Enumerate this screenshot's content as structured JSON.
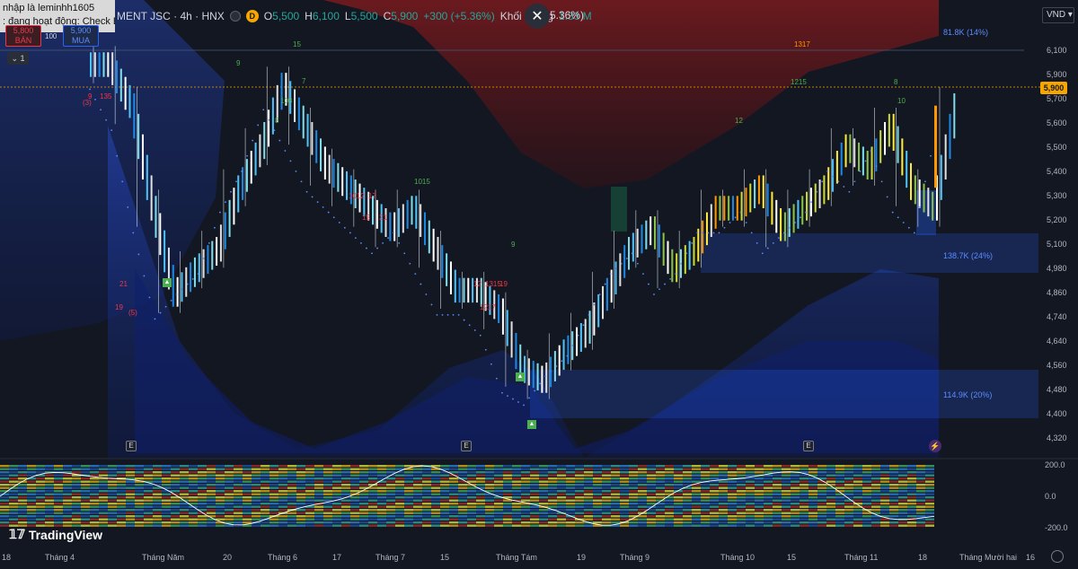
{
  "tooltip": {
    "line1": "nhập là leminhh1605",
    "line2": ": đang hoạt động: Check BTC"
  },
  "header": {
    "symbol": "MENT JSC · 4h · HNX",
    "d_badge": "D",
    "ohlc": {
      "o_label": "O",
      "o": "5,500",
      "h_label": "H",
      "h": "6,100",
      "l_label": "L",
      "l": "5,500",
      "c_label": "C",
      "c": "5,900",
      "change": "+300 (+5.36%)",
      "volume_label": "Khối lượng",
      "volume": "1.33 M"
    },
    "change_pct_2": "5.36%)"
  },
  "trade": {
    "sell_price": "5,800",
    "sell_label": "BÁN",
    "spread": "100",
    "buy_price": "5,900",
    "buy_label": "MUA"
  },
  "collapse_label": "1",
  "currency": "VND",
  "price_axis": [
    "6,100",
    "5,900",
    "5,700",
    "5,600",
    "5,500",
    "5,400",
    "5,300",
    "5,200",
    "5,100",
    "4,980",
    "4,860",
    "4,740",
    "4,640",
    "4,560",
    "4,480",
    "4,400",
    "4,320"
  ],
  "current_price": "5,900",
  "osc_axis": [
    "200.0",
    "0.0",
    "-200.0"
  ],
  "zones": {
    "z1": "81.8K (14%)",
    "z2": "138.7K (24%)",
    "z3": "114.9K (20%)"
  },
  "time_axis": [
    "18",
    "Tháng 4",
    "Tháng Năm",
    "20",
    "Tháng 6",
    "17",
    "Tháng 7",
    "15",
    "Tháng Tám",
    "19",
    "Tháng 9",
    "Tháng 10",
    "15",
    "Tháng 11",
    "18",
    "Tháng Mười hai",
    "16"
  ],
  "events": {
    "e": "E",
    "flash": "⚡"
  },
  "brand": "TradingView",
  "signals": [
    {
      "t": "9",
      "c": "red"
    },
    {
      "t": "135",
      "c": "red"
    },
    {
      "t": "(3)",
      "c": "red"
    },
    {
      "t": "21",
      "c": "red"
    },
    {
      "t": "19",
      "c": "red"
    },
    {
      "t": "(5)",
      "c": "red"
    },
    {
      "t": "15",
      "c": "green"
    },
    {
      "t": "9",
      "c": "green"
    },
    {
      "t": "7",
      "c": "green"
    },
    {
      "t": "108",
      "c": "green"
    },
    {
      "t": "8",
      "c": "green"
    },
    {
      "t": "1012",
      "c": "red"
    },
    {
      "t": "17",
      "c": "red"
    },
    {
      "t": "15",
      "c": "red"
    },
    {
      "t": "21",
      "c": "red"
    },
    {
      "t": "12",
      "c": "red"
    },
    {
      "t": "1315",
      "c": "red"
    },
    {
      "t": "19",
      "c": "red"
    },
    {
      "t": "1217",
      "c": "red"
    },
    {
      "t": "1015",
      "c": "green"
    },
    {
      "t": "9",
      "c": "green"
    },
    {
      "t": "12",
      "c": "green"
    },
    {
      "t": "1215",
      "c": "green"
    },
    {
      "t": "1317",
      "c": "orange"
    },
    {
      "t": "8",
      "c": "green"
    },
    {
      "t": "10",
      "c": "green"
    }
  ],
  "colors": {
    "bg": "#131722",
    "accent": "#f7a600",
    "up": "#26a69a",
    "down": "#f23645",
    "band_blue": "#1e3fa8",
    "band_red": "#8b1a1a"
  },
  "chart_data": {
    "type": "candlestick",
    "title": "",
    "timeframe": "4h",
    "exchange": "HNX",
    "ylim": [
      4280,
      6240
    ],
    "current": {
      "open": 5500,
      "high": 6100,
      "low": 5500,
      "close": 5900,
      "change": 300,
      "change_pct": 5.36,
      "volume": "1.33 M"
    },
    "series": [
      {
        "name": "close",
        "values": [
          6100,
          5900,
          5400,
          4980,
          5100,
          5200,
          5500,
          5700,
          6000,
          5800,
          5600,
          5500,
          5400,
          5300,
          5400,
          5200,
          5000,
          5000,
          4900,
          4620,
          4560,
          4700,
          4800,
          5000,
          5200,
          5300,
          5100,
          5200,
          5400,
          5400,
          5500,
          5300,
          5400,
          5500,
          5700,
          5600,
          5800,
          5500,
          5400,
          5900
        ]
      }
    ],
    "zones": [
      {
        "label": "81.8K (14%)",
        "price_range": [
          6060,
          6140
        ]
      },
      {
        "label": "138.7K (24%)",
        "price_range": [
          5000,
          5160
        ]
      },
      {
        "label": "114.9K (20%)",
        "price_range": [
          4400,
          4580
        ]
      }
    ],
    "oscillator": {
      "ylim": [
        -250,
        250
      ],
      "ticks": [
        200,
        0,
        -200
      ]
    }
  }
}
